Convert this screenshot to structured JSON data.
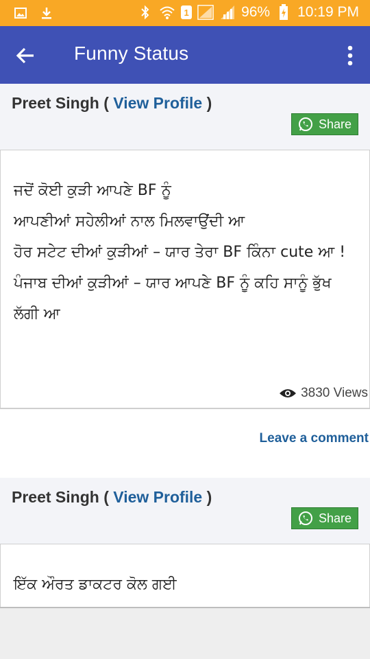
{
  "status_bar": {
    "battery": "96%",
    "time": "10:19 PM",
    "sim_label": "1",
    "icons": [
      "gallery-icon",
      "download-icon",
      "bluetooth-icon",
      "wifi-icon",
      "sim-icon",
      "signal-icon",
      "signal-icon",
      "battery-charging-icon"
    ]
  },
  "app_bar": {
    "title": "Funny Status",
    "back_icon": "back-arrow-icon",
    "menu_icon": "overflow-menu-icon",
    "color": "#3f51b5"
  },
  "posts": [
    {
      "author": "Preet Singh",
      "open_paren": " ( ",
      "view_profile": "View Profile",
      "close_paren": " )",
      "share_label": "Share",
      "text": "ਜਦੋਂ ਕੋਈ ਕੁੜੀ ਆਪਣੇ BF ਨੂੰ\nਆਪਣੀਆਂ ਸਹੇਲੀਆਂ ਨਾਲ ਮਿਲਵਾਉਂਦੀ ਆ\nਹੋਰ ਸਟੇਟ ਦੀਆਂ ਕੁੜੀਆਂ – ਯਾਰ ਤੇਰਾ BF ਕਿੰਨਾ cute ਆ !\nਪੰਜਾਬ ਦੀਆਂ ਕੁੜੀਆਂ – ਯਾਰ ਆਪਣੇ BF ਨੂੰ ਕਹਿ ਸਾਨੂੰ ਭੁੱਖ ਲੱਗੀ ਆ",
      "views": "3830 Views",
      "comment_label": "Leave a comment"
    },
    {
      "author": "Preet Singh",
      "open_paren": " ( ",
      "view_profile": "View Profile",
      "close_paren": " )",
      "share_label": "Share",
      "text": "ਇੱਕ ਔਰਤ ਡਾਕਟਰ ਕੋਲ ਗਈ"
    }
  ],
  "colors": {
    "status_bar": "#f9a825",
    "link": "#1f5f9a",
    "share_button": "#43a047"
  }
}
